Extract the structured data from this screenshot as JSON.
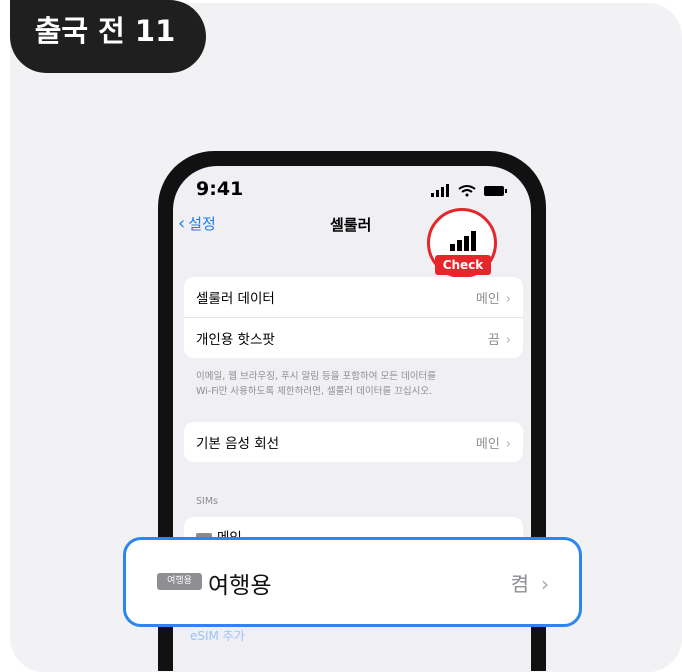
{
  "badge": {
    "text": "출국 전 11"
  },
  "status_bar": {
    "time": "9:41",
    "icons": [
      "cellular-signal-icon",
      "wifi-icon",
      "battery-icon"
    ]
  },
  "nav": {
    "back_label": "설정",
    "title": "셀룰러"
  },
  "highlight": {
    "tag": "Check",
    "color": "#e5272b"
  },
  "group1": [
    {
      "label": "셀룰러 데이터",
      "value": "메인"
    },
    {
      "label": "개인용 핫스팟",
      "value": "끔"
    }
  ],
  "note": {
    "line1": "이메일, 웹 브라우징, 푸시 알림 등을 포함하여 모든 데이터를",
    "line2": "Wi-Fi만 사용하도록 제한하려면, 셀룰러 데이터를 끄십시오."
  },
  "voice": {
    "label": "기본 음성 회선",
    "value": "메인"
  },
  "sims": {
    "header": "SIMs",
    "primary": "메인",
    "add": "eSIM 추가"
  },
  "callout": {
    "tag": "여행용",
    "label": "여행용",
    "value": "켬",
    "border_color": "#2b86ee"
  }
}
